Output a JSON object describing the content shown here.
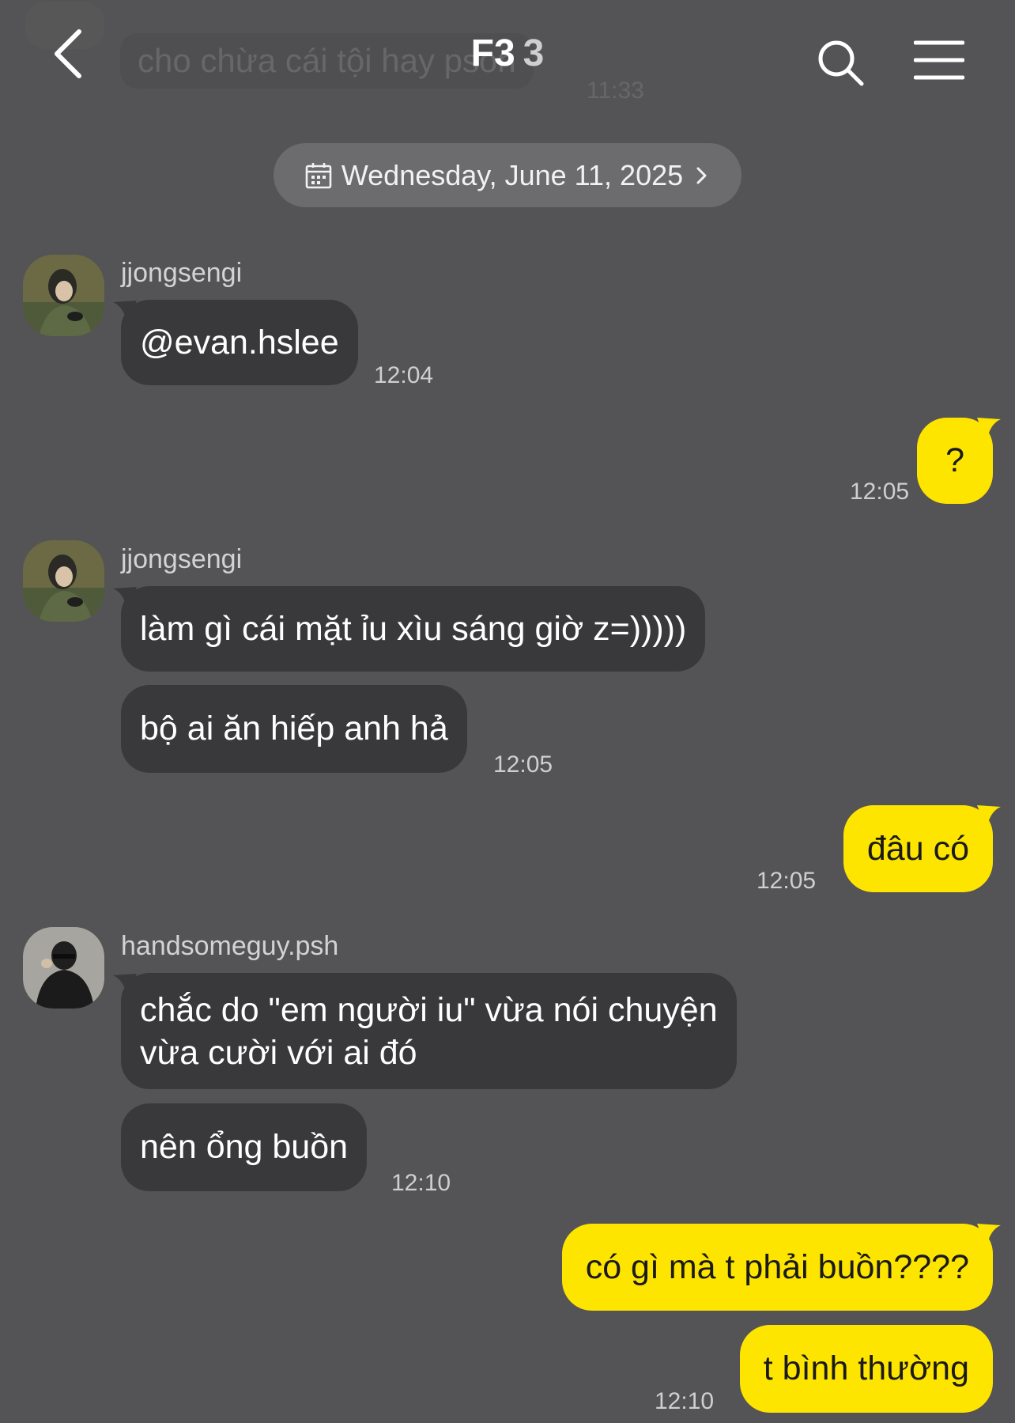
{
  "header": {
    "ghost_message": "cho chừa cái tội hay pson",
    "ghost_time": "11:33",
    "title": "F3",
    "member_count": "3"
  },
  "date_divider": {
    "label": "Wednesday, June 11, 2025"
  },
  "messages": [
    {
      "sender": "jjongsengi",
      "bubbles": [
        "@evan.hslee"
      ],
      "time": "12:04"
    },
    {
      "sender": "me",
      "bubbles": [
        "?"
      ],
      "time": "12:05"
    },
    {
      "sender": "jjongsengi",
      "bubbles": [
        "làm gì cái mặt ỉu xìu sáng giờ z=)))))",
        "bộ ai ăn hiếp anh hả"
      ],
      "time": "12:05"
    },
    {
      "sender": "me",
      "bubbles": [
        "đâu có"
      ],
      "time": "12:05"
    },
    {
      "sender": "handsomeguy.psh",
      "bubbles": [
        "chắc do \"em người iu\" vừa nói chuyện",
        "vừa cười với ai đó",
        "nên ổng buồn"
      ],
      "time": "12:10"
    },
    {
      "sender": "me",
      "bubbles": [
        "có gì mà t phải buồn????",
        "t bình thường"
      ],
      "time": "12:10"
    }
  ],
  "colors": {
    "background": "#545355",
    "incoming_bubble": "#39393b",
    "outgoing_bubble": "#fee500",
    "date_pill": "#6c6b6d"
  },
  "icons": [
    "back-chevron-icon",
    "search-icon",
    "menu-icon",
    "calendar-icon",
    "chevron-right-icon",
    "avatar-photo"
  ]
}
